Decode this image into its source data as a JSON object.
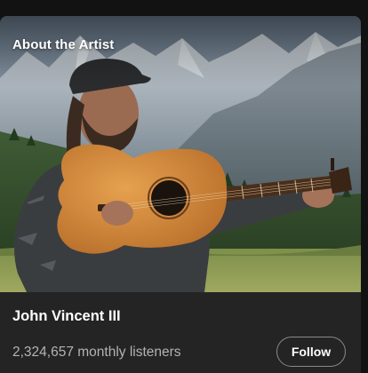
{
  "section": {
    "title": "About the Artist"
  },
  "artist": {
    "name": "John Vincent III",
    "listeners": "2,324,657 monthly listeners"
  },
  "actions": {
    "follow_label": "Follow"
  },
  "colors": {
    "card_background": "#242424",
    "page_background": "#121212",
    "secondary_text": "#b3b3b3",
    "guitar_body": "#d38b3e"
  }
}
